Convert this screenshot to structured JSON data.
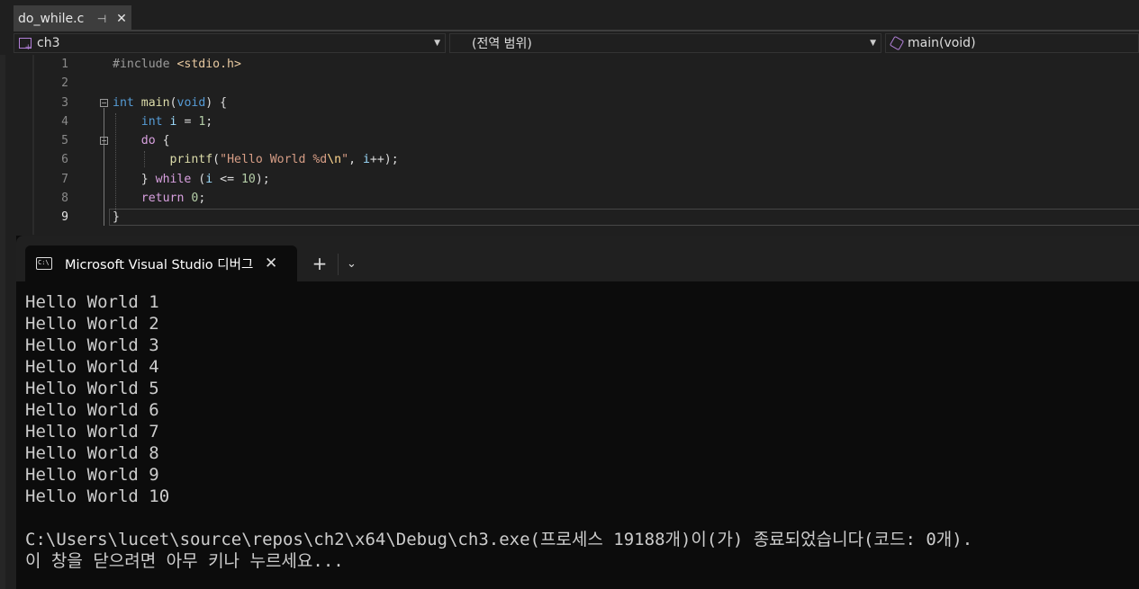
{
  "editor_tab": {
    "filename": "do_while.c",
    "pin": "⊣",
    "close": "✕"
  },
  "navbar": {
    "project": "ch3",
    "scope": "(전역 범위)",
    "member": "main(void)",
    "dropdown_arrow": "▼"
  },
  "code_lines": [
    {
      "n": "1"
    },
    {
      "n": "2"
    },
    {
      "n": "3"
    },
    {
      "n": "4"
    },
    {
      "n": "5"
    },
    {
      "n": "6"
    },
    {
      "n": "7"
    },
    {
      "n": "8"
    },
    {
      "n": "9"
    }
  ],
  "code": {
    "l1_pp": "#include ",
    "l1_inc": "<stdio.h>",
    "l3_kw": "int",
    "l3_fn": "main",
    "l3_p1": "(",
    "l3_void": "void",
    "l3_p2": ") {",
    "l4_kw": "int",
    "l4_var": "i",
    "l4_eq": " = ",
    "l4_num": "1",
    "l4_semi": ";",
    "l5_kw": "do",
    "l5_brace": " {",
    "l6_fn": "printf",
    "l6_p1": "(",
    "l6_str": "\"Hello World %d",
    "l6_esc": "\\n",
    "l6_str2": "\"",
    "l6_rest": ", ",
    "l6_var": "i",
    "l6_end": "++);",
    "l7_brace": "} ",
    "l7_kw": "while",
    "l7_p1": " (",
    "l7_var": "i",
    "l7_op": " <= ",
    "l7_num": "10",
    "l7_end": ");",
    "l8_kw": "return",
    "l8_sp": " ",
    "l8_num": "0",
    "l8_semi": ";",
    "l9": "}"
  },
  "terminal": {
    "tab_icon_text": "C:\\",
    "tab_title": "Microsoft Visual Studio 디버그",
    "tab_close": "✕",
    "new_tab": "+",
    "dropdown": "⌄",
    "lines": [
      "Hello World 1",
      "Hello World 2",
      "Hello World 3",
      "Hello World 4",
      "Hello World 5",
      "Hello World 6",
      "Hello World 7",
      "Hello World 8",
      "Hello World 9",
      "Hello World 10",
      "",
      "C:\\Users\\lucet\\source\\repos\\ch2\\x64\\Debug\\ch3.exe(프로세스 19188개)이(가) 종료되었습니다(코드: 0개).",
      "이 창을 닫으려면 아무 키나 누르세요..."
    ]
  },
  "colors": {
    "keyword": "#569cd6",
    "control": "#d8a0df",
    "function": "#dcdcaa",
    "string": "#d69d85",
    "number": "#b5cea8",
    "variable": "#9cdcfe"
  }
}
